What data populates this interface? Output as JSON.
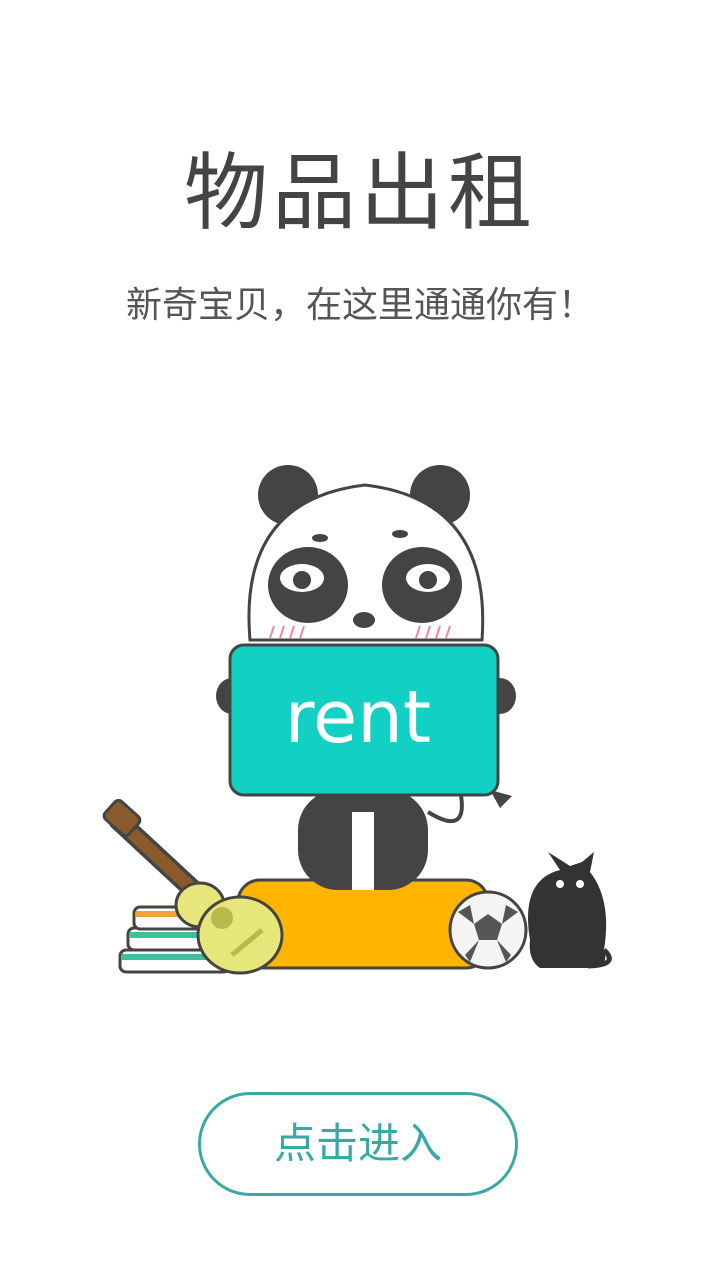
{
  "header": {
    "title": "物品出租",
    "subtitle": "新奇宝贝，在这里通通你有！"
  },
  "illustration": {
    "sign_text": "rent",
    "sign_color": "#12d0c4",
    "cushion_color": "#ffb400"
  },
  "actions": {
    "enter_label": "点击进入"
  },
  "colors": {
    "accent": "#3aa9a3",
    "text_dark": "#444444"
  }
}
